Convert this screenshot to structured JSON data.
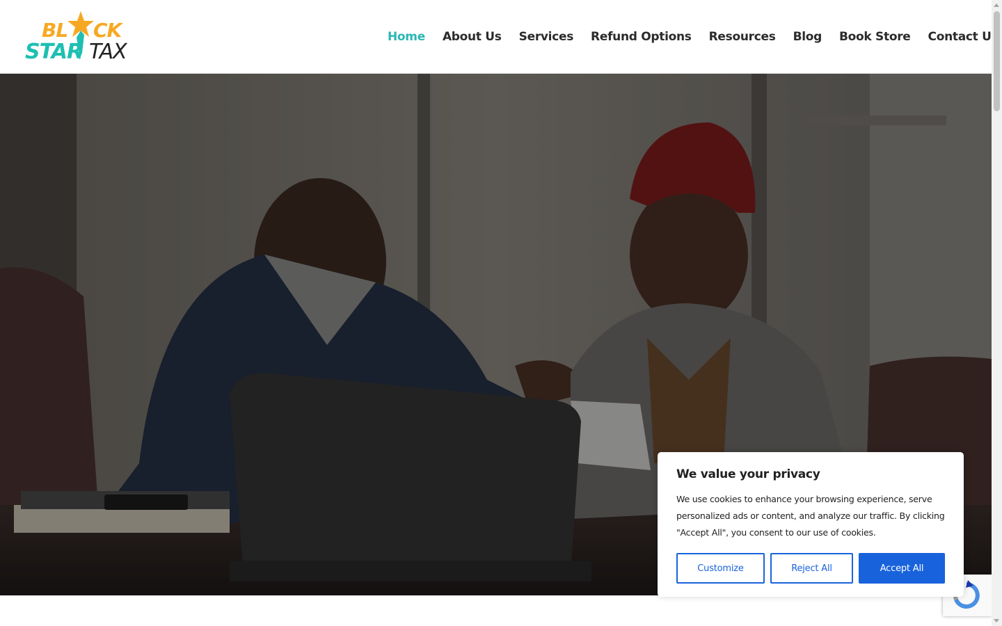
{
  "brand": {
    "logo_line1": "BLACK",
    "logo_line2_a": "STAR",
    "logo_line2_b": "TAX",
    "colors": {
      "logo_orange": "#f7a823",
      "logo_teal": "#1ebfb2",
      "nav_active": "#2bb7b3",
      "nav_text": "#2b2b2b",
      "accent_blue": "#1863dc"
    }
  },
  "nav": {
    "items": [
      {
        "label": "Home",
        "active": true
      },
      {
        "label": "About Us",
        "active": false
      },
      {
        "label": "Services",
        "active": false
      },
      {
        "label": "Refund Options",
        "active": false
      },
      {
        "label": "Resources",
        "active": false
      },
      {
        "label": "Blog",
        "active": false
      },
      {
        "label": "Book Store",
        "active": false
      },
      {
        "label": "Contact Us",
        "active": false
      }
    ],
    "cart_icon": "shopping-cart-icon"
  },
  "cookie_banner": {
    "title": "We value your privacy",
    "body": "We use cookies to enhance your browsing experience, serve personalized ads or content, and analyze our traffic. By clicking \"Accept All\", you consent to our use of cookies.",
    "buttons": {
      "customize": "Customize",
      "reject": "Reject All",
      "accept": "Accept All"
    }
  },
  "recaptcha_icon": "recaptcha-icon"
}
